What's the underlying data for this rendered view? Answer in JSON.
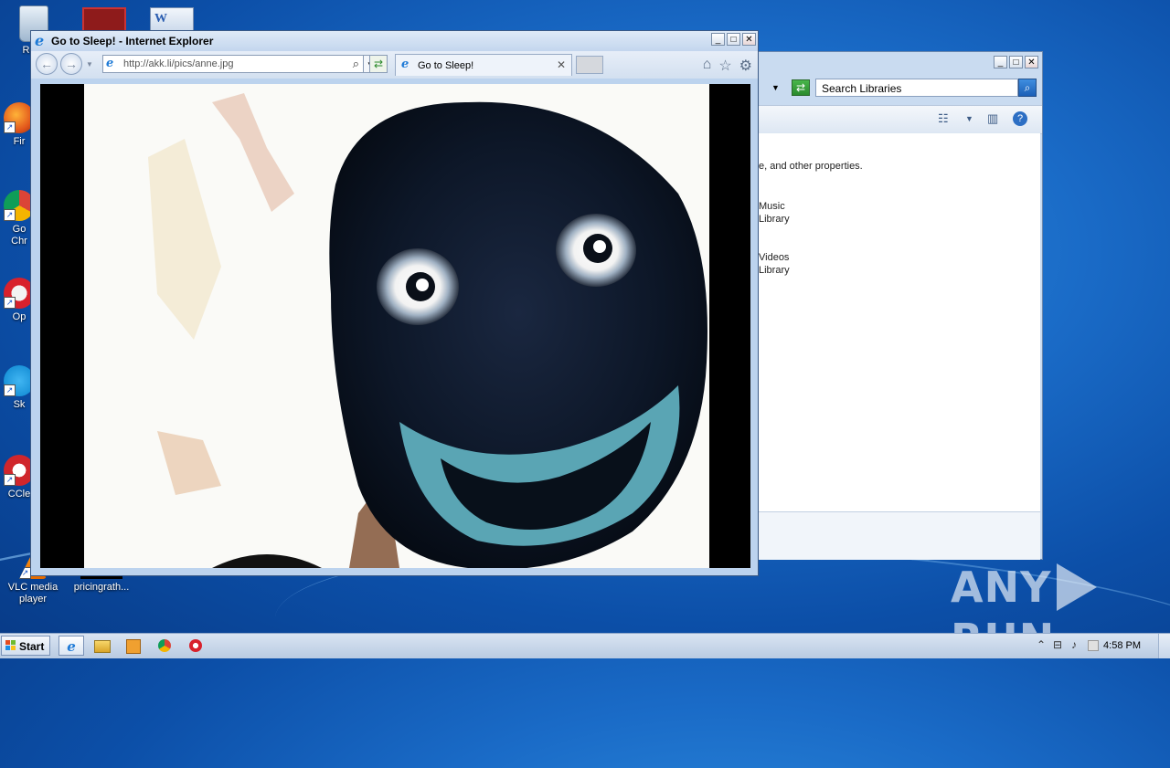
{
  "desktop": {
    "icons": [
      {
        "label": "Recy",
        "icon": "recycle-bin-icon"
      },
      {
        "label": "Fir",
        "icon": "firefox-icon"
      },
      {
        "label": "Go\nChr",
        "icon": "chrome-icon"
      },
      {
        "label": "Op",
        "icon": "opera-icon"
      },
      {
        "label": "Sk",
        "icon": "skype-icon"
      },
      {
        "label": "CCle",
        "icon": "ccleaner-icon"
      },
      {
        "label": "VLC media\nplayer",
        "icon": "vlc-icon"
      },
      {
        "label": "pricingrath...",
        "icon": "file-icon"
      }
    ]
  },
  "ie": {
    "window_title": "Go to Sleep! - Internet Explorer",
    "address_url": "http://akk.li/pics/anne.jpg",
    "tab_label": "Go to Sleep!",
    "tab_close": "✕",
    "window_buttons": {
      "minimize": "_",
      "maximize": "□",
      "close": "✕"
    },
    "accent": "#1e7ad6"
  },
  "explorer": {
    "search_placeholder": "Search Libraries",
    "body_lines": [
      "e, and other properties.",
      "Music",
      "Library",
      "Videos",
      "Library"
    ],
    "window_buttons": {
      "minimize": "_",
      "maximize": "□",
      "close": "✕"
    }
  },
  "taskbar": {
    "start_label": "Start",
    "pinned": [
      "internet-explorer-icon",
      "windows-explorer-icon",
      "media-player-icon",
      "chrome-icon",
      "opera-icon"
    ],
    "clock": "4:58 PM"
  },
  "watermark": {
    "left": "ANY",
    "right": "RUN"
  }
}
